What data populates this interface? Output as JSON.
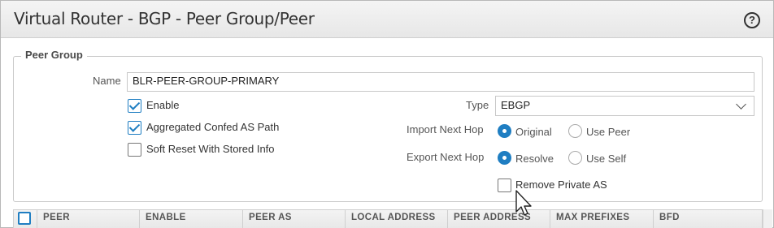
{
  "dialog": {
    "title": "Virtual Router - BGP - Peer Group/Peer",
    "help_icon": "question-circle-icon",
    "help_glyph": "?"
  },
  "peer_group": {
    "legend": "Peer Group",
    "name_label": "Name",
    "name_value": "BLR-PEER-GROUP-PRIMARY",
    "enable_label": "Enable",
    "enable_checked": true,
    "aggregated_label": "Aggregated Confed AS Path",
    "aggregated_checked": true,
    "soft_reset_label": "Soft Reset With Stored Info",
    "soft_reset_checked": false,
    "type_label": "Type",
    "type_value": "EBGP",
    "import_label": "Import Next Hop",
    "import_options": [
      "Original",
      "Use Peer"
    ],
    "import_selected": "Original",
    "export_label": "Export Next Hop",
    "export_options": [
      "Resolve",
      "Use Self"
    ],
    "export_selected": "Resolve",
    "remove_private_label": "Remove Private AS",
    "remove_private_checked": false
  },
  "peer_table": {
    "columns": [
      "PEER",
      "ENABLE",
      "PEER AS",
      "LOCAL ADDRESS",
      "PEER ADDRESS",
      "MAX PREFIXES",
      "BFD"
    ]
  },
  "colors": {
    "accent": "#1f7ec2",
    "title_bar": "#ececec"
  }
}
